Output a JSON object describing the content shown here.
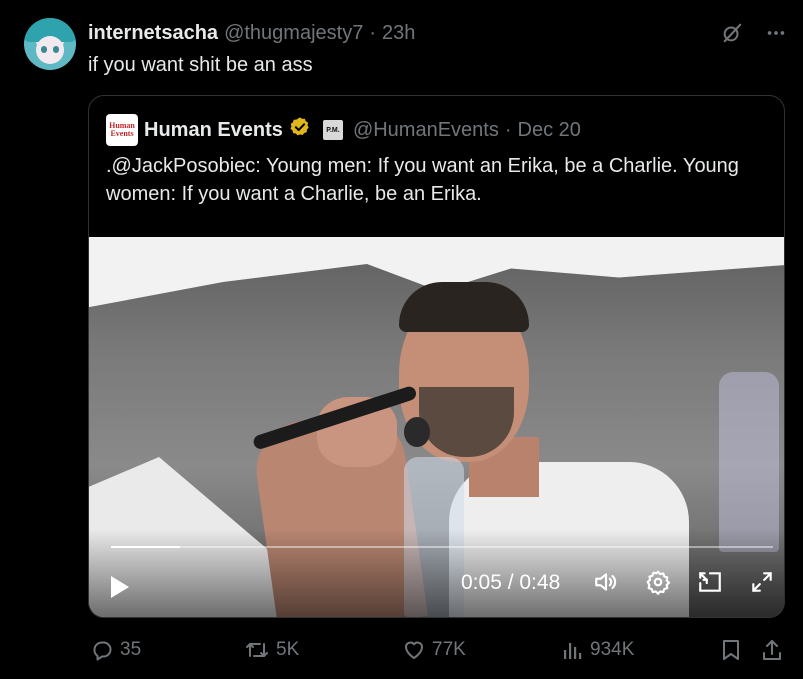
{
  "post": {
    "display_name": "internetsacha",
    "handle": "@thugmajesty7",
    "separator": "·",
    "time": "23h",
    "text": "if you want shit be an ass",
    "avatar_icon": "anime-avatar"
  },
  "quote": {
    "logo_line1": "Human",
    "logo_line2": "Events",
    "display_name": "Human Events",
    "verified_icon": "gold-verified-badge",
    "affiliate_badge": "P.M.",
    "handle": "@HumanEvents",
    "separator": "·",
    "date": "Dec 20",
    "text": ".@JackPosobiec: Young men: If you want an Erika, be a Charlie. Young women: If you want a Charlie, be an Erika."
  },
  "video": {
    "time_readout": "0:05 / 0:48",
    "progress_fraction": 0.104,
    "icons": [
      "play-icon",
      "volume-icon",
      "settings-icon",
      "picture-in-picture-icon",
      "fullscreen-icon"
    ]
  },
  "actions": {
    "replies": "35",
    "reposts": "5K",
    "likes": "77K",
    "views": "934K"
  },
  "colors": {
    "background": "#000000",
    "text": "#e7e9ea",
    "secondary": "#71767b",
    "border": "#2f3336",
    "verified_gold": "#e2b719"
  }
}
